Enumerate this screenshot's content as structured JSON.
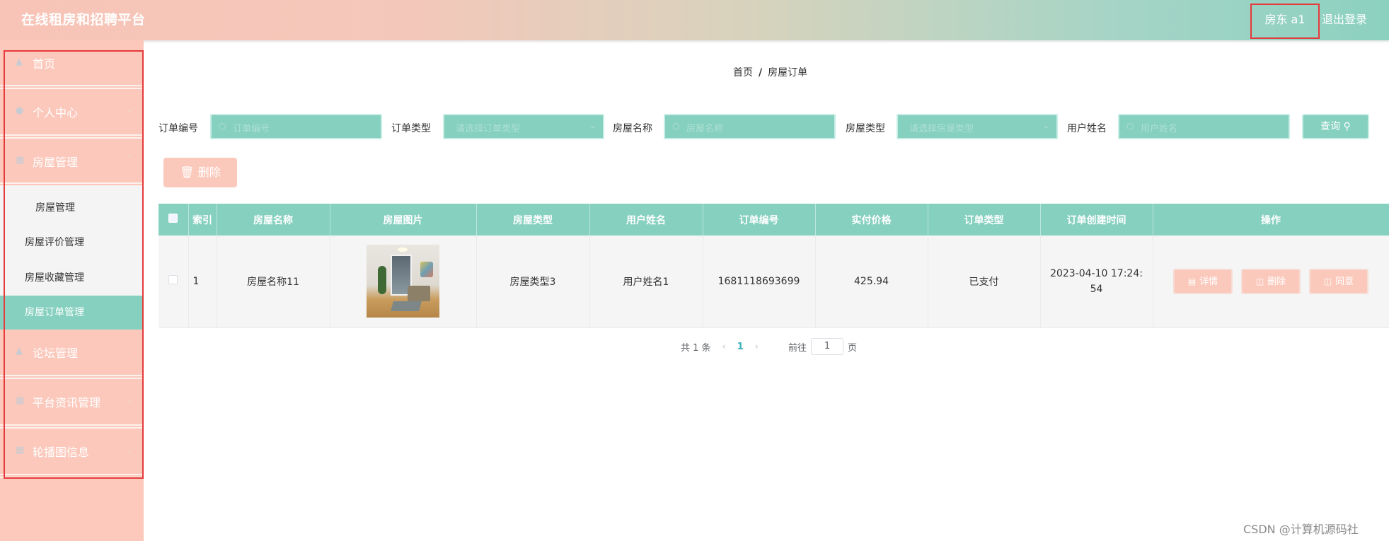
{
  "header": {
    "title": "在线租房和招聘平台",
    "user_label": "房东 a1",
    "logout_label": "退出登录"
  },
  "sidebar": {
    "items": [
      {
        "label": "首页",
        "icon": "home-icon"
      },
      {
        "label": "个人中心",
        "icon": "user-icon"
      },
      {
        "label": "房屋管理",
        "icon": "grid-icon"
      },
      {
        "label": "论坛管理",
        "icon": "forum-icon"
      },
      {
        "label": "平台资讯管理",
        "icon": "grid-icon"
      },
      {
        "label": "轮播图信息",
        "icon": "grid-icon"
      }
    ],
    "submenu": [
      {
        "label": "房屋管理"
      },
      {
        "label": "房屋评价管理"
      },
      {
        "label": "房屋收藏管理"
      },
      {
        "label": "房屋订单管理",
        "active": true
      }
    ]
  },
  "breadcrumb": {
    "home": "首页",
    "separator": "/",
    "current": "房屋订单"
  },
  "filters": {
    "order_no": {
      "label": "订单编号",
      "placeholder": "订单编号",
      "value": ""
    },
    "order_type": {
      "label": "订单类型",
      "placeholder": "请选择订单类型",
      "value": ""
    },
    "house_name": {
      "label": "房屋名称",
      "placeholder": "房屋名称",
      "value": ""
    },
    "house_type": {
      "label": "房屋类型",
      "placeholder": "请选择房屋类型",
      "value": ""
    },
    "user_name": {
      "label": "用户姓名",
      "placeholder": "用户姓名",
      "value": ""
    },
    "search_label": "查询"
  },
  "toolbar": {
    "delete_label": "删除"
  },
  "table": {
    "columns": [
      "",
      "索引",
      "房屋名称",
      "房屋图片",
      "房屋类型",
      "用户姓名",
      "订单编号",
      "实付价格",
      "订单类型",
      "订单创建时间",
      "操作"
    ],
    "rows": [
      {
        "index": "1",
        "house_name": "房屋名称11",
        "image_alt": "living-room photo",
        "house_type": "房屋类型3",
        "user_name": "用户姓名1",
        "order_no": "1681118693699",
        "price": "425.94",
        "order_type": "已支付",
        "created_at": "2023-04-10 17:24:54",
        "actions": [
          "详情",
          "删除",
          "同意"
        ]
      }
    ]
  },
  "pagination": {
    "total_text": "共 1 条",
    "current_page": "1",
    "goto_label": "前往",
    "goto_value": "1",
    "page_suffix": "页"
  },
  "watermark": "CSDN @计算机源码社",
  "colors": {
    "header_start": "#f8c4b8",
    "header_end": "#8cd1c0",
    "accent_teal": "#86d0bf",
    "accent_pink": "#fbc9bc",
    "highlight_red": "#e6393a"
  }
}
